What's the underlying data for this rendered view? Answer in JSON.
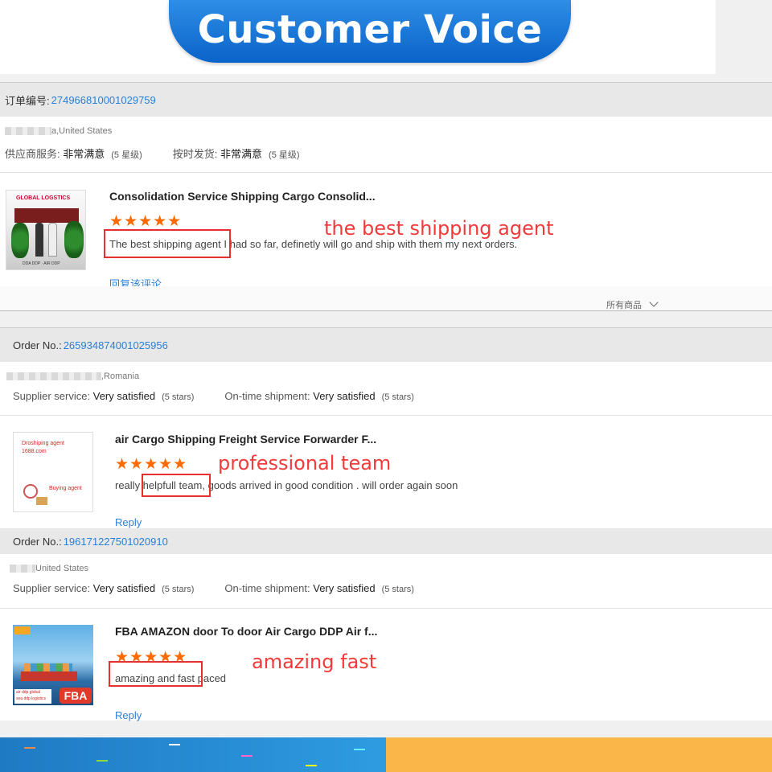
{
  "banner": {
    "title": "Customer Voice"
  },
  "reviews": [
    {
      "order_label": "订单编号:",
      "order_no": "274966810001029759",
      "buyer_suffix": "a,United States",
      "supplier_label": "供应商服务:",
      "supplier_value": "非常满意",
      "supplier_stars": "(5 星级)",
      "shipment_label": "按时发货:",
      "shipment_value": "非常满意",
      "shipment_stars": "(5 星级)",
      "thumb": {
        "line1": "GLOBAL  LOGSTICS",
        "line2": "DDA DDP · AIR DDP"
      },
      "product_title": "Consolidation Service Shipping Cargo Consolid...",
      "stars": "★★★★★",
      "comment": "The best shipping agent I had so far, definetly will go and ship with them my next orders.",
      "annotation": "the best shipping agent",
      "reply": "回复该评论",
      "all_products": "所有商品"
    },
    {
      "order_label": "Order No.:",
      "order_no": "265934874001025956",
      "buyer_suffix": ",Romania",
      "supplier_label": "Supplier service:",
      "supplier_value": "Very satisfied",
      "supplier_stars": "(5 stars)",
      "shipment_label": "On-time shipment:",
      "shipment_value": "Very satisfied",
      "shipment_stars": "(5 stars)",
      "thumb": {
        "line1": "Droshiping agent",
        "line2": "1688.com",
        "line3": "Buying agent"
      },
      "product_title": "air Cargo Shipping Freight Service Forwarder F...",
      "stars": "★★★★★",
      "comment": "really helpfull team, goods arrived in good condition . will order again soon",
      "annotation": "professional team",
      "reply": "Reply"
    },
    {
      "order_label": "Order No.:",
      "order_no": "196171227501020910",
      "buyer_suffix": "United States",
      "supplier_label": "Supplier service:",
      "supplier_value": "Very satisfied",
      "supplier_stars": "(5 stars)",
      "shipment_label": "On-time shipment:",
      "shipment_value": "Very satisfied",
      "shipment_stars": "(5 stars)",
      "thumb": {
        "badge": "FBA",
        "line1": "air ddp  global",
        "line2": "sea ddp  logistics"
      },
      "product_title": "FBA AMAZON door To door Air Cargo DDP Air f...",
      "stars": "★★★★★",
      "comment": "amazing and fast paced",
      "annotation": "amazing fast",
      "reply": "Reply"
    }
  ],
  "colors": {
    "accent": "#2a7fd4",
    "star": "#ff6a00",
    "annotation": "#f23a3a",
    "banner": "#0a63c9",
    "footer_right": "#fbb64a"
  }
}
